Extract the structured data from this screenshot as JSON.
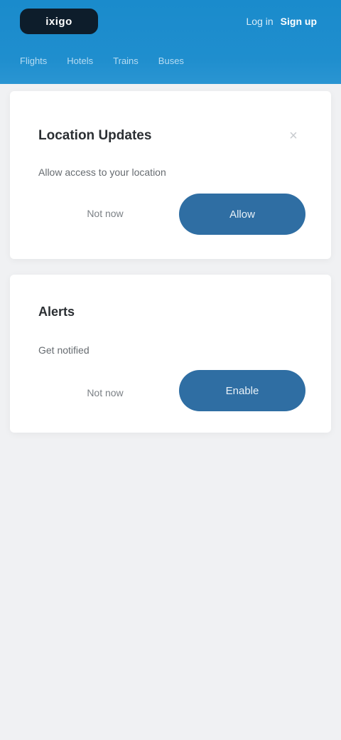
{
  "header": {
    "logo_text": "ixigo",
    "links": [
      "Log in",
      "Sign up"
    ],
    "subnav": [
      "Flights",
      "Hotels",
      "Trains",
      "Buses"
    ]
  },
  "cards": [
    {
      "title": "Location Updates",
      "text": "Allow access to your location",
      "secondary_label": "Not now",
      "primary_label": "Allow",
      "close_glyph": "×"
    },
    {
      "title": "Alerts",
      "text": "Get notified",
      "secondary_label": "Not now",
      "primary_label": "Enable"
    }
  ],
  "colors": {
    "header": "#1a8bcc",
    "primary_button": "#2f6ea3",
    "background": "#f0f1f3"
  }
}
